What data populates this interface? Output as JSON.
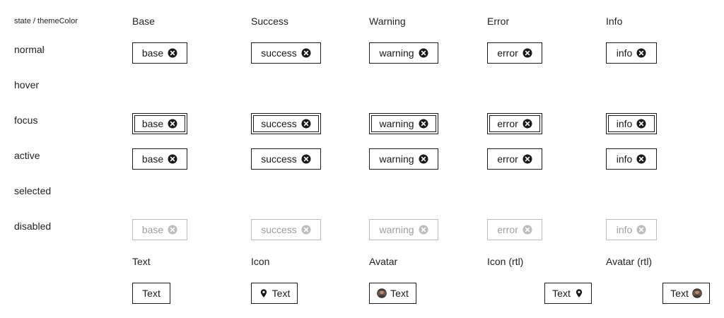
{
  "corner": "state / themeColor",
  "columns": [
    "Base",
    "Success",
    "Warning",
    "Error",
    "Info"
  ],
  "rows": [
    "normal",
    "hover",
    "focus",
    "active",
    "selected",
    "disabled"
  ],
  "chip_labels": [
    "base",
    "success",
    "warning",
    "error",
    "info"
  ],
  "variant_headers": [
    "Text",
    "Icon",
    "Avatar",
    "Icon (rtl)",
    "Avatar (rtl)"
  ],
  "variant_chips": [
    "Text",
    "Text",
    "Text",
    "Text",
    "Text"
  ],
  "icons": {
    "close": "close-circle-icon",
    "pin": "map-pin-icon",
    "avatar": "avatar-image"
  },
  "colors": {
    "border": "#1a1a1a",
    "disabled": "#9e9e9e"
  }
}
